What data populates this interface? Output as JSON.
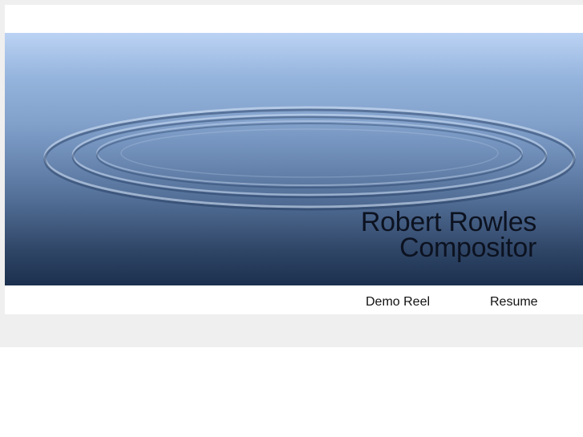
{
  "header": {
    "name": "Robert Rowles",
    "role": "Compositor"
  },
  "banner": {
    "image": "water-ripple-image",
    "colors": {
      "sky_top": "#bcd3f4",
      "water_bottom": "#213a5e"
    }
  },
  "nav": {
    "demo_reel": "Demo Reel",
    "resume": "Resume"
  },
  "colors": {
    "page_background": "#efefef",
    "card_background": "#ffffff",
    "text": "#111111"
  }
}
